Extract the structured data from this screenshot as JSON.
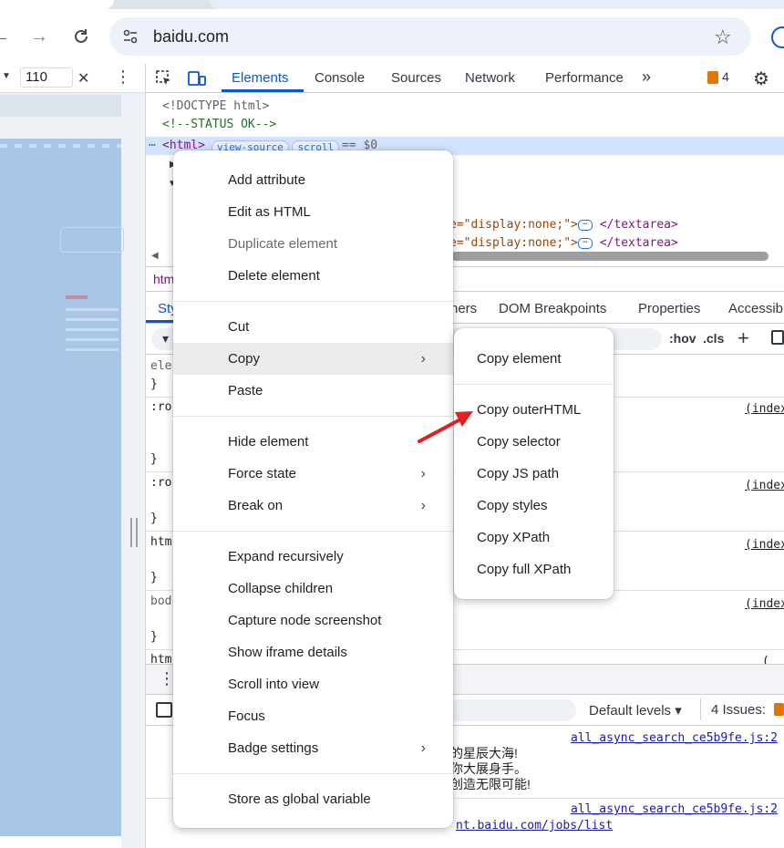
{
  "browser": {
    "url": "baidu.com",
    "zoom_value": "110",
    "icons": [
      "back-arrow-icon",
      "forward-arrow-icon",
      "reload-icon",
      "site-info-icon",
      "bookmark-star-icon",
      "profile-icon"
    ]
  },
  "devtools": {
    "tabs": [
      "Elements",
      "Console",
      "Sources",
      "Network",
      "Performance"
    ],
    "active_tab": "Elements",
    "issues_badge": "4",
    "dom_lines": {
      "doctype": "<!DOCTYPE html>",
      "comment": "<!--STATUS OK-->",
      "html_tag": "<html>",
      "pill_view_source": "view-source",
      "pill_scroll": "scroll",
      "eq_dollar": "== $0",
      "textarea_attr_1": "e=\"display:none;\">",
      "textarea_close_1": "</textarea>",
      "textarea_attr_2": "e=\"display:none;\">",
      "textarea_close_2": "</textarea>"
    },
    "breadcrumb_fragment": "htm",
    "styles_tabs": [
      "Sty",
      "ners",
      "DOM Breakpoints",
      "Properties",
      "Accessib"
    ],
    "filter_tools": {
      "hov": ":hov",
      "cls": ".cls",
      "plus": "+"
    },
    "style_rules": [
      {
        "selector": "ele",
        "closing": "}"
      },
      {
        "selector": ":ro",
        "closing": "}",
        "source": "(index"
      },
      {
        "selector": ":ro",
        "closing": "}",
        "source": "(index"
      },
      {
        "selector": "htm",
        "closing": "}",
        "source": "(index"
      },
      {
        "selector": "bod",
        "closing": "}",
        "source": "(index"
      },
      {
        "selector": "htm",
        "source": "("
      }
    ],
    "console": {
      "levels_label": "Default levels ▾",
      "issues_label": "4 Issues:",
      "messages": [
        {
          "link": "all_async_search_ce5b9fe.js:2",
          "lines": [
            "的星辰大海!",
            "你大展身手。",
            "创造无限可能!"
          ]
        },
        {
          "link": "all_async_search_ce5b9fe.js:2",
          "tail_link": "nt.baidu.com/jobs/list"
        }
      ]
    }
  },
  "context_menu": {
    "groups": [
      [
        {
          "label": "Add attribute"
        },
        {
          "label": "Edit as HTML"
        },
        {
          "label": "Duplicate element",
          "disabled": true
        },
        {
          "label": "Delete element"
        }
      ],
      [
        {
          "label": "Cut"
        },
        {
          "label": "Copy",
          "submenu": true,
          "highlighted": true
        },
        {
          "label": "Paste"
        }
      ],
      [
        {
          "label": "Hide element"
        },
        {
          "label": "Force state",
          "submenu": true
        },
        {
          "label": "Break on",
          "submenu": true
        }
      ],
      [
        {
          "label": "Expand recursively"
        },
        {
          "label": "Collapse children"
        },
        {
          "label": "Capture node screenshot"
        },
        {
          "label": "Show iframe details"
        },
        {
          "label": "Scroll into view"
        },
        {
          "label": "Focus"
        },
        {
          "label": "Badge settings",
          "submenu": true
        }
      ],
      [
        {
          "label": "Store as global variable"
        }
      ]
    ]
  },
  "copy_submenu": {
    "groups": [
      [
        "Copy element"
      ],
      [
        "Copy outerHTML",
        "Copy selector",
        "Copy JS path",
        "Copy styles",
        "Copy XPath",
        "Copy full XPath"
      ]
    ],
    "arrow_target": "Copy outerHTML",
    "arrow_color": "#e0211f"
  },
  "colors": {
    "accent": "#0b57d0",
    "selection": "#d3e3fd",
    "device_preview": "#a9c6e6"
  }
}
